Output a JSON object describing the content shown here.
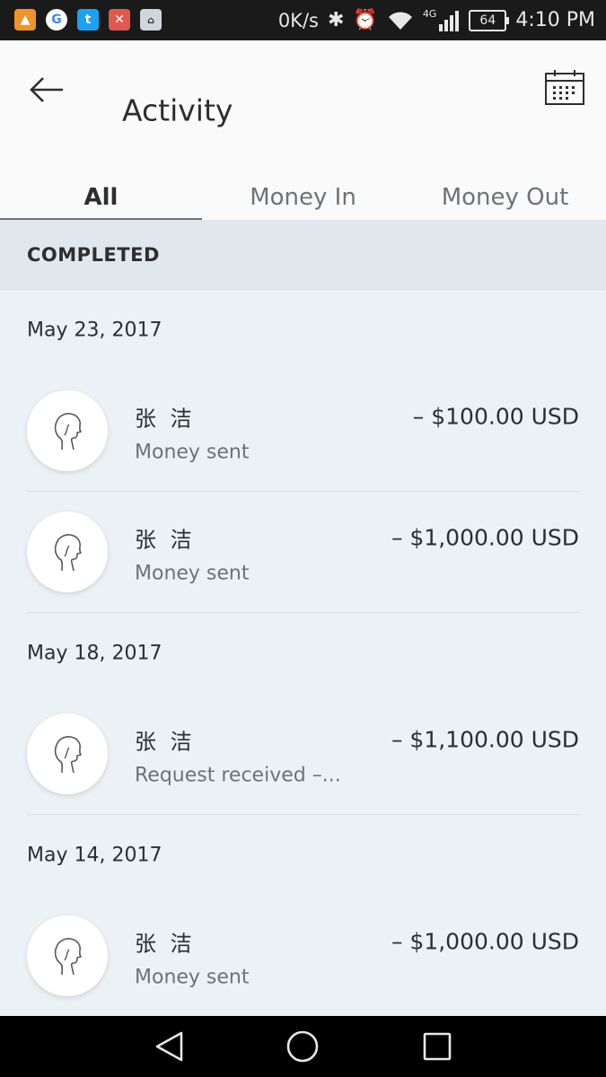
{
  "status_bar": {
    "apps": [
      {
        "icon": "photo-app-icon",
        "color": "#f0932b"
      },
      {
        "icon": "google-icon",
        "color": "#4285f4"
      },
      {
        "icon": "twitter-icon",
        "color": "#1da1f2"
      },
      {
        "icon": "app-icon",
        "color": "#e0594f"
      },
      {
        "icon": "network-app-icon",
        "color": "#cfd6dc"
      }
    ],
    "net_speed": "0K/s",
    "network_type": "4G",
    "battery": "64",
    "time": "4:10 PM"
  },
  "header": {
    "title": "Activity",
    "back_icon": "arrow-left-icon",
    "calendar_icon": "calendar-icon"
  },
  "tabs": [
    {
      "label": "All",
      "active": true
    },
    {
      "label": "Money In",
      "active": false
    },
    {
      "label": "Money Out",
      "active": false
    }
  ],
  "section": {
    "heading": "COMPLETED"
  },
  "dates": [
    "May 23, 2017",
    "May 18, 2017",
    "May 14, 2017"
  ],
  "transactions": [
    {
      "name": "张 洁",
      "description": "Money sent",
      "amount": "– $100.00 USD"
    },
    {
      "name": "张 洁",
      "description": "Money sent",
      "amount": "– $1,000.00 USD"
    },
    {
      "name": "张 洁",
      "description": "Request received –...",
      "amount": "– $1,100.00 USD"
    },
    {
      "name": "张 洁",
      "description": "Money sent",
      "amount": "– $1,000.00 USD"
    }
  ],
  "nav": {
    "back": "triangle-back-icon",
    "home": "circle-home-icon",
    "recents": "square-recents-icon"
  }
}
